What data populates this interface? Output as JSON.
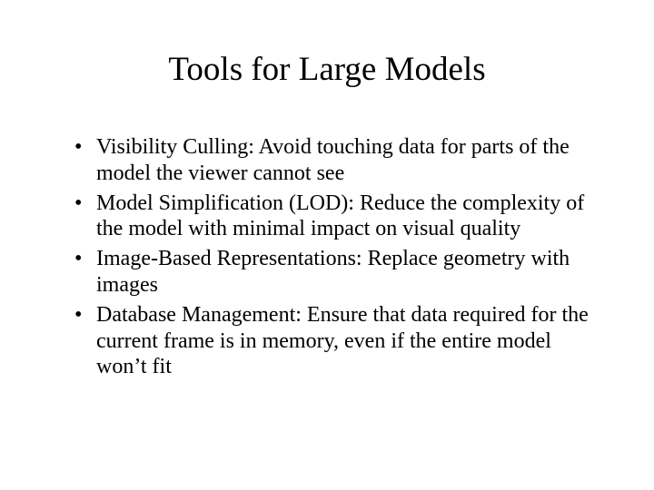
{
  "slide": {
    "title": "Tools for Large Models",
    "bullets": [
      "Visibility Culling: Avoid touching data for parts of the model the viewer cannot see",
      "Model Simplification (LOD): Reduce the complexity of the model with minimal impact on visual quality",
      "Image-Based Representations: Replace geometry with images",
      "Database Management: Ensure that data required for the current frame is in memory, even if the entire model won’t fit"
    ]
  }
}
